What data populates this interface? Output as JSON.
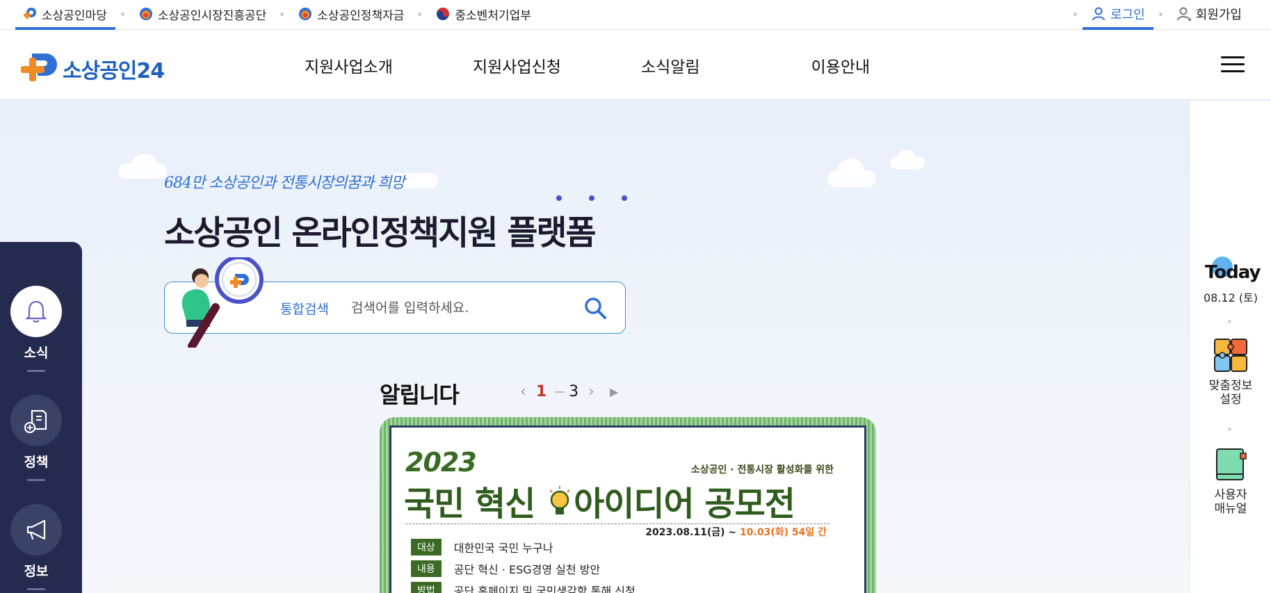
{
  "utility_bar": {
    "links": [
      {
        "label": "소상공인마당",
        "icon": "sosang-logo-icon",
        "active": true
      },
      {
        "label": "소상공인시장진흥공단",
        "icon": "semas-logo-icon"
      },
      {
        "label": "소상공인정책자금",
        "icon": "semas-logo-icon"
      },
      {
        "label": "중소벤처기업부",
        "icon": "korea-emblem-icon"
      }
    ],
    "login": "로그인",
    "signup": "회원가입"
  },
  "header": {
    "logo_text": "소상공인24",
    "nav": [
      "지원사업소개",
      "지원사업신청",
      "소식알림",
      "이용안내"
    ],
    "menu_icon": "hamburger-menu-icon"
  },
  "hero": {
    "slogan": "684만 소상공인과 전통시장의꿈과 희망",
    "title_light": "소상공인 ",
    "title_bold": "온라인정책지원 플랫폼",
    "search": {
      "category": "통합검색",
      "placeholder": "검색어를 입력하세요."
    }
  },
  "notice": {
    "title": "알립니다",
    "current_page": "1",
    "total_pages": "3"
  },
  "banner": {
    "year": "2023",
    "subtitle": "소상공인 · 전통시장 활성화를 위한",
    "title_part1": "국민 혁신",
    "title_part2": "아이디어 공모전",
    "date_start": "2023.08.11(금) ~ ",
    "date_end": "10.03(화) 54일 간",
    "rows": [
      {
        "tag": "대상",
        "value": "대한민국 국민 누구나"
      },
      {
        "tag": "내용",
        "value": "공단 혁신 · ESG경영 실천 방안"
      },
      {
        "tag": "방법",
        "value": "공단 홈페이지 및 국민생각함 통해 신청"
      }
    ]
  },
  "left_sidebar": [
    {
      "label": "소식",
      "icon": "bell-icon"
    },
    {
      "label": "정책",
      "icon": "document-add-icon"
    },
    {
      "label": "정보",
      "icon": "megaphone-icon"
    }
  ],
  "right_sidebar": {
    "today_label": "Today",
    "date": "08.12 (토)",
    "items": [
      {
        "label_line1": "맞춤정보",
        "label_line2": "설정",
        "icon": "puzzle-icon"
      },
      {
        "label_line1": "사용자",
        "label_line2": "매뉴얼",
        "icon": "manual-book-icon"
      }
    ]
  },
  "colors": {
    "brand_blue": "#2f6fd6",
    "sidebar_navy": "#242b4f",
    "banner_green": "#3a6a24",
    "accent_orange": "#e8731f"
  }
}
